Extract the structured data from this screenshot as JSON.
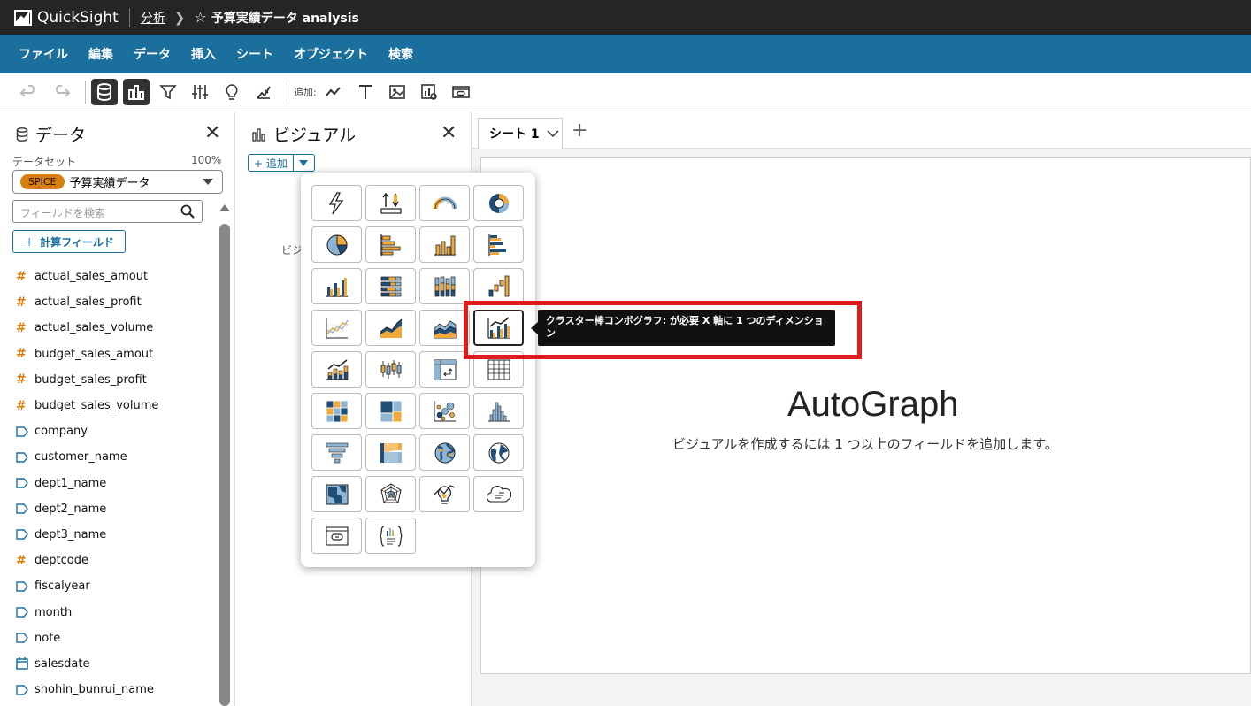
{
  "app": {
    "name": "QuickSight"
  },
  "breadcrumb": {
    "link": "分析",
    "title": "予算実績データ analysis"
  },
  "menu": [
    "ファイル",
    "編集",
    "データ",
    "挿入",
    "シート",
    "オブジェクト",
    "検索"
  ],
  "toolbar": {
    "add_label": "追加:"
  },
  "data_panel": {
    "title": "データ",
    "dataset_label": "データセット",
    "dataset_percent": "100%",
    "spice_badge": "SPICE",
    "dataset_name": "予算実績データ",
    "search_placeholder": "フィールドを検索",
    "calc_field_button": "計算フィールド",
    "fields": [
      {
        "name": "actual_sales_amout",
        "type": "measure"
      },
      {
        "name": "actual_sales_profit",
        "type": "measure"
      },
      {
        "name": "actual_sales_volume",
        "type": "measure"
      },
      {
        "name": "budget_sales_amout",
        "type": "measure"
      },
      {
        "name": "budget_sales_profit",
        "type": "measure"
      },
      {
        "name": "budget_sales_volume",
        "type": "measure"
      },
      {
        "name": "company",
        "type": "dimension"
      },
      {
        "name": "customer_name",
        "type": "dimension"
      },
      {
        "name": "dept1_name",
        "type": "dimension"
      },
      {
        "name": "dept2_name",
        "type": "dimension"
      },
      {
        "name": "dept3_name",
        "type": "dimension"
      },
      {
        "name": "deptcode",
        "type": "measure"
      },
      {
        "name": "fiscalyear",
        "type": "dimension"
      },
      {
        "name": "month",
        "type": "dimension"
      },
      {
        "name": "note",
        "type": "dimension"
      },
      {
        "name": "salesdate",
        "type": "date"
      },
      {
        "name": "shohin_bunrui_name",
        "type": "dimension"
      }
    ]
  },
  "visual_panel": {
    "title": "ビジュアル",
    "add_button": "追加",
    "hint_partial": "ビジ"
  },
  "sheet": {
    "tab_label": "シート 1"
  },
  "autograph": {
    "title": "AutoGraph",
    "subtitle": "ビジュアルを作成するには 1 つ以上のフィールドを追加します。"
  },
  "tooltip": {
    "text": "クラスター棒コンボグラフ: が必要 X 軸に 1 つのディメンション"
  },
  "colors": {
    "accent_blue": "#1b6f9d",
    "orange": "#d97d0e",
    "highlight_red": "#e01b1b",
    "navy": "#1f4e79"
  },
  "visual_types": [
    "kpi-icon",
    "top-bottom-ranked-icon",
    "gauge-icon",
    "donut-icon",
    "pie-icon",
    "horizontal-bar-icon",
    "vertical-bar-icon",
    "clustered-horizontal-bar-icon",
    "clustered-vertical-bar-icon",
    "stacked-horizontal-bar-icon",
    "stacked-vertical-bar-icon",
    "waterfall-icon",
    "line-icon",
    "area-icon",
    "stacked-area-icon",
    "clustered-bar-combo-icon",
    "stacked-bar-combo-icon",
    "box-plot-icon",
    "pivot-table-icon",
    "table-icon",
    "heat-map-icon",
    "tree-map-icon",
    "scatter-icon",
    "histogram-icon",
    "funnel-icon",
    "sankey-icon",
    "points-on-map-icon",
    "filled-map-icon",
    "layer-map-icon",
    "radar-icon",
    "insight-icon",
    "word-cloud-icon",
    "custom-visual-icon",
    "text-box-icon"
  ]
}
